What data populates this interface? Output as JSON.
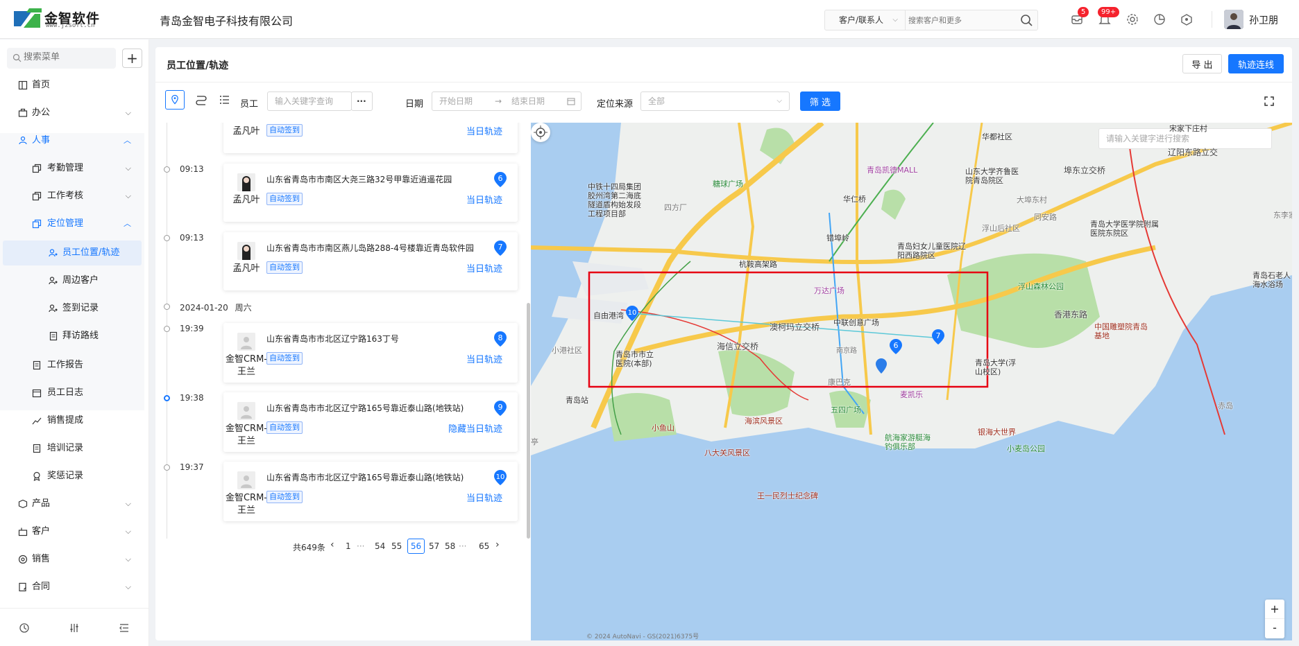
{
  "header": {
    "logo_name": "金智软件",
    "logo_url": "www.jzsoft.cn",
    "company": "青岛金智电子科技有限公司",
    "search_type": "客户/联系人",
    "search_placeholder": "搜索客户和更多",
    "badges": {
      "tasks": "5",
      "notifications": "99+"
    },
    "username": "孙卫朋"
  },
  "sidebar": {
    "search_placeholder": "搜索菜单",
    "items": [
      {
        "label": "首页",
        "icon": "home-icon"
      },
      {
        "label": "办公",
        "icon": "office-icon"
      },
      {
        "label": "人事",
        "icon": "hr-icon"
      },
      {
        "label": "考勤管理",
        "icon": "copy-icon"
      },
      {
        "label": "工作考核",
        "icon": "copy-icon"
      },
      {
        "label": "定位管理",
        "icon": "copy-icon"
      },
      {
        "label": "员工位置/轨迹",
        "icon": "person-pin-icon"
      },
      {
        "label": "周边客户",
        "icon": "person-pin-icon"
      },
      {
        "label": "签到记录",
        "icon": "person-pin-icon"
      },
      {
        "label": "拜访路线",
        "icon": "doc-icon"
      },
      {
        "label": "工作报告",
        "icon": "doc-icon"
      },
      {
        "label": "员工日志",
        "icon": "calendar-icon"
      },
      {
        "label": "销售提成",
        "icon": "chart-icon"
      },
      {
        "label": "培训记录",
        "icon": "doc-icon"
      },
      {
        "label": "奖惩记录",
        "icon": "award-icon"
      },
      {
        "label": "产品",
        "icon": "box-icon"
      },
      {
        "label": "客户",
        "icon": "customer-icon"
      },
      {
        "label": "销售",
        "icon": "sales-icon"
      },
      {
        "label": "合同",
        "icon": "contract-icon"
      }
    ]
  },
  "page": {
    "title": "员工位置/轨迹",
    "export_label": "导 出",
    "track_label": "轨迹连线"
  },
  "filters": {
    "employee_label": "员工",
    "employee_placeholder": "输入关键字查询",
    "more": "···",
    "date_label": "日期",
    "start_date_placeholder": "开始日期",
    "arrow": "→",
    "end_date_placeholder": "结束日期",
    "source_label": "定位来源",
    "source_value": "全部",
    "filter_btn": "筛 选"
  },
  "records": [
    {
      "time": "",
      "name": "孟凡叶",
      "address": "",
      "tag": "自动签到",
      "link": "当日轨迹",
      "num": ""
    },
    {
      "time": "09:13",
      "name": "孟凡叶",
      "address": "山东省青岛市市南区大尧三路32号甲靠近逍遥花园",
      "tag": "自动签到",
      "link": "当日轨迹",
      "num": "6"
    },
    {
      "time": "09:13",
      "name": "孟凡叶",
      "address": "山东省青岛市市南区燕儿岛路288-4号楼靠近青岛软件园",
      "tag": "自动签到",
      "link": "当日轨迹",
      "num": "7"
    },
    {
      "time": "19:39",
      "name": "金智CRM-王兰",
      "address": "山东省青岛市市北区辽宁路163丁号",
      "tag": "自动签到",
      "link": "当日轨迹",
      "num": "8"
    },
    {
      "time": "19:38",
      "name": "金智CRM-王兰",
      "address": "山东省青岛市市北区辽宁路165号靠近泰山路(地铁站)",
      "tag": "自动签到",
      "link": "隐藏当日轨迹",
      "num": "9"
    },
    {
      "time": "19:37",
      "name": "金智CRM-王兰",
      "address": "山东省青岛市市北区辽宁路165号靠近泰山路(地铁站)",
      "tag": "自动签到",
      "link": "当日轨迹",
      "num": "10"
    }
  ],
  "date_header": {
    "date": "2024-01-20",
    "weekday": "周六"
  },
  "pager": {
    "total": "共649条",
    "prev": "‹",
    "next": "›",
    "pages": [
      "1",
      "···",
      "54",
      "55",
      "56",
      "57",
      "58",
      "···",
      "65"
    ],
    "current": "56"
  },
  "map": {
    "search_placeholder": "请输入关键字进行搜索",
    "copyright": "© 2024 AutoNavi - GS(2021)6375号",
    "zoom_in": "+",
    "zoom_out": "-",
    "markers": [
      "10",
      "6",
      "7"
    ],
    "labels": [
      "华都社区",
      "宋家下庄村",
      "辽阳东路立交",
      "青岛凯德MALL",
      "山东大学齐鲁医院青岛院区",
      "埠东立交桥",
      "中铁十四局集团胶州湾第二海底隧道盾构始发段工程项目部",
      "糖球广场",
      "四方厂",
      "华仁桥",
      "大埠东村",
      "浮山后社区",
      "同安路",
      "东李家",
      "青岛大学医学院附属医院东院区",
      "错埠岭",
      "青岛妇女儿童医院辽阳西路院区",
      "杭鞍高架路",
      "浮山森林公园",
      "青岛石老人海水浴场",
      "万达广场",
      "自由港湾",
      "中联创意广场",
      "澳柯玛立交桥",
      "香港东路",
      "中国雕塑院青岛基地",
      "小港社区",
      "海信立交桥",
      "青岛市市立医院(本部)",
      "南京路",
      "青岛大学(浮山校区)",
      "康巴克",
      "麦凯乐",
      "青岛站",
      "五四广场",
      "海滨风景区",
      "小鱼山",
      "航海家游艇海钓俱乐部",
      "银海大世界",
      "八大关风景区",
      "小麦岛公园",
      "王一民烈士纪念碑",
      "赤岛",
      "亭"
    ]
  },
  "colors": {
    "primary": "#1677ff",
    "selection_box": "#e60012",
    "track_line": "#5bc8d8"
  }
}
